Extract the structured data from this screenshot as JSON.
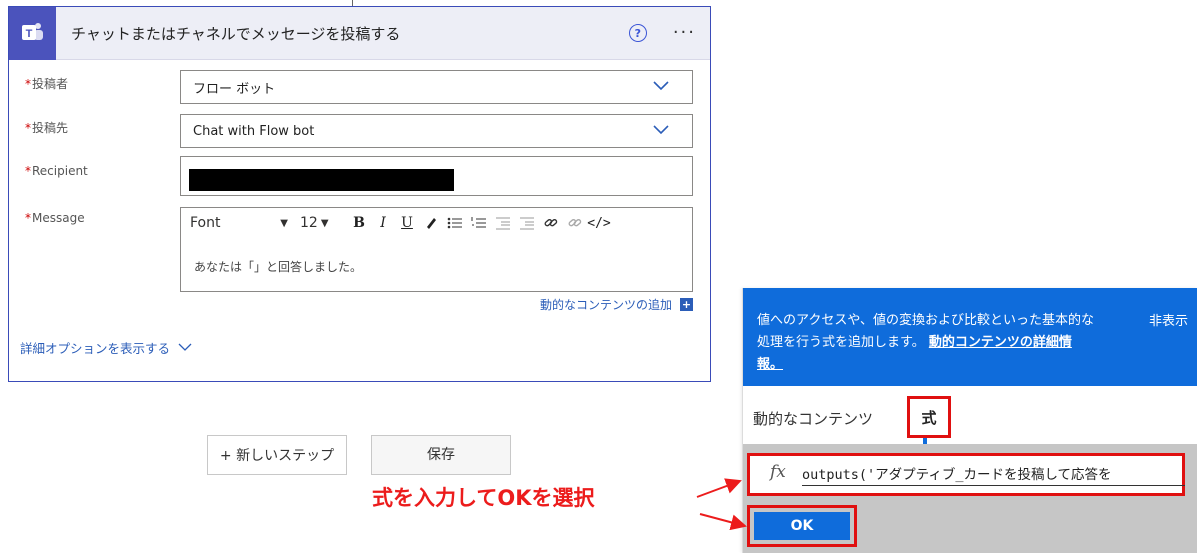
{
  "card": {
    "title": "チャットまたはチャネルでメッセージを投稿する",
    "help_glyph": "?",
    "more_glyph": "···",
    "icon": "teams-icon"
  },
  "fields": {
    "poster": {
      "label": "投稿者",
      "value": "フロー ボット"
    },
    "post_in": {
      "label": "投稿先",
      "value": "Chat with Flow bot"
    },
    "recipient": {
      "label": "Recipient",
      "value_redacted": true
    },
    "message": {
      "label": "Message",
      "font": "Font",
      "font_size": "12",
      "body": "あなたは「」と回答しました。"
    },
    "required_mark": "*"
  },
  "add_dynamic_content": "動的なコンテンツの追加",
  "advanced_options": "詳細オプションを表示する",
  "buttons": {
    "new_step": "+ 新しいステップ",
    "save": "保存"
  },
  "panel": {
    "info_text": "値へのアクセスや、値の変換および比較といった基本的な処理を行う式を追加します。",
    "info_link": "動的コンテンツの詳細情報。",
    "hide": "非表示",
    "tabs": [
      "動的なコンテンツ",
      "式"
    ],
    "fx": "fx",
    "expression": "outputs('アダプティブ_カードを投稿して応答を",
    "ok": "OK"
  },
  "annotation": {
    "text": "式を入力してOKを選択",
    "color": "#ec1c1c"
  },
  "colors": {
    "accent": "#0f6cdb",
    "teams": "#4b53bc",
    "link": "#2b5db8",
    "highlight": "#e01010"
  }
}
